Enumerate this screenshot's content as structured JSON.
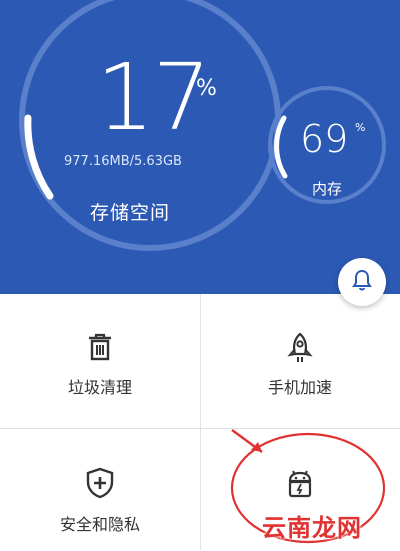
{
  "storage": {
    "percent": "17",
    "percent_symbol": "%",
    "detail": "977.16MB/5.63GB",
    "label": "存储空间",
    "fill_fraction": 0.17
  },
  "memory": {
    "percent": "69",
    "percent_symbol": "%",
    "label": "内存",
    "fill_fraction": 0.69
  },
  "notification": {
    "icon": "bell-icon"
  },
  "tiles": [
    {
      "label": "垃圾清理",
      "icon": "trash-icon"
    },
    {
      "label": "手机加速",
      "icon": "rocket-icon"
    },
    {
      "label": "安全和隐私",
      "icon": "shield-plus-icon"
    },
    {
      "label": "",
      "icon": "android-bag-icon"
    }
  ],
  "watermark": "云南龙网",
  "colors": {
    "header_bg": "#2b59b4",
    "accent": "#2b59b4",
    "annotation": "#e03232"
  }
}
